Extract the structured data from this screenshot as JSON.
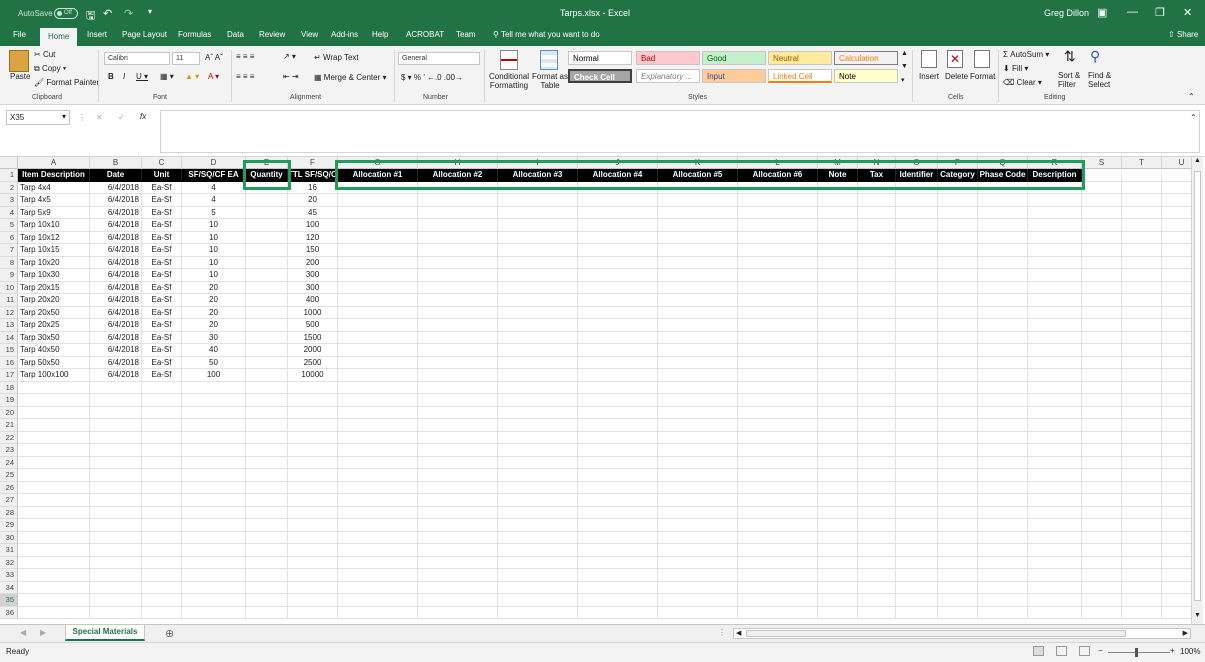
{
  "title_bar": {
    "autosave_label": "AutoSave",
    "autosave_state": "Off",
    "document": "Tarps.xlsx - Excel",
    "user": "Greg Dillon"
  },
  "tabs": [
    "File",
    "Home",
    "Insert",
    "Page Layout",
    "Formulas",
    "Data",
    "Review",
    "View",
    "Add-ins",
    "Help",
    "ACROBAT",
    "Team"
  ],
  "tell_me": "Tell me what you want to do",
  "share": "Share",
  "ribbon": {
    "clipboard": {
      "paste": "Paste",
      "cut": "Cut",
      "copy": "Copy",
      "format_painter": "Format Painter",
      "label": "Clipboard"
    },
    "font": {
      "name": "Calibri",
      "size": "11",
      "label": "Font"
    },
    "alignment": {
      "wrap_text": "Wrap Text",
      "merge_center": "Merge & Center",
      "label": "Alignment"
    },
    "number": {
      "format": "General",
      "label": "Number"
    },
    "styles": {
      "conditional": "Conditional Formatting",
      "format_as_table": "Format as Table",
      "items": [
        {
          "label": "Normal",
          "bg": "#ffffff",
          "fg": "#000000"
        },
        {
          "label": "Bad",
          "bg": "#ffc7ce",
          "fg": "#9c0006"
        },
        {
          "label": "Good",
          "bg": "#c6efce",
          "fg": "#006100"
        },
        {
          "label": "Neutral",
          "bg": "#ffeb9c",
          "fg": "#9c5700"
        },
        {
          "label": "Calculation",
          "bg": "#f2f2f2",
          "fg": "#fa7d00"
        },
        {
          "label": "Check Cell",
          "bg": "#a5a5a5",
          "fg": "#ffffff"
        },
        {
          "label": "Explanatory ...",
          "bg": "#ffffff",
          "fg": "#7f7f7f"
        },
        {
          "label": "Input",
          "bg": "#ffcc99",
          "fg": "#3f3f76"
        },
        {
          "label": "Linked Cell",
          "bg": "#ffffff",
          "fg": "#fa7d00"
        },
        {
          "label": "Note",
          "bg": "#ffffcc",
          "fg": "#000000"
        }
      ],
      "label": "Styles"
    },
    "cells": {
      "insert": "Insert",
      "delete": "Delete",
      "format": "Format",
      "label": "Cells"
    },
    "editing": {
      "autosum": "AutoSum",
      "fill": "Fill",
      "clear": "Clear",
      "sort_filter": "Sort & Filter",
      "find_select": "Find & Select",
      "label": "Editing"
    }
  },
  "name_box": "X35",
  "columns": [
    "A",
    "B",
    "C",
    "D",
    "E",
    "F",
    "G",
    "H",
    "I",
    "J",
    "K",
    "L",
    "M",
    "N",
    "O",
    "P",
    "Q",
    "R",
    "S",
    "T",
    "U"
  ],
  "header_row": [
    "Item Description",
    "Date",
    "Unit",
    "SF/SQ/CF EA",
    "Quantity",
    "TTL SF/SQ/CF",
    "Allocation #1",
    "Allocation #2",
    "Allocation #3",
    "Allocation #4",
    "Allocation #5",
    "Allocation #6",
    "Note",
    "Tax",
    "Identifier",
    "Category",
    "Phase Code",
    "Description"
  ],
  "rows": [
    [
      "Tarp 4x4",
      "6/4/2018",
      "Ea-Sf",
      "4",
      "",
      "16"
    ],
    [
      "Tarp 4x5",
      "6/4/2018",
      "Ea-Sf",
      "4",
      "",
      "20"
    ],
    [
      "Tarp 5x9",
      "6/4/2018",
      "Ea-Sf",
      "5",
      "",
      "45"
    ],
    [
      "Tarp 10x10",
      "6/4/2018",
      "Ea-Sf",
      "10",
      "",
      "100"
    ],
    [
      "Tarp 10x12",
      "6/4/2018",
      "Ea-Sf",
      "10",
      "",
      "120"
    ],
    [
      "Tarp 10x15",
      "6/4/2018",
      "Ea-Sf",
      "10",
      "",
      "150"
    ],
    [
      "Tarp 10x20",
      "6/4/2018",
      "Ea-Sf",
      "10",
      "",
      "200"
    ],
    [
      "Tarp 10x30",
      "6/4/2018",
      "Ea-Sf",
      "10",
      "",
      "300"
    ],
    [
      "Tarp 20x15",
      "6/4/2018",
      "Ea-Sf",
      "20",
      "",
      "300"
    ],
    [
      "Tarp 20x20",
      "6/4/2018",
      "Ea-Sf",
      "20",
      "",
      "400"
    ],
    [
      "Tarp 20x50",
      "6/4/2018",
      "Ea-Sf",
      "20",
      "",
      "1000"
    ],
    [
      "Tarp 20x25",
      "6/4/2018",
      "Ea-Sf",
      "20",
      "",
      "500"
    ],
    [
      "Tarp 30x50",
      "6/4/2018",
      "Ea-Sf",
      "30",
      "",
      "1500"
    ],
    [
      "Tarp 40x50",
      "6/4/2018",
      "Ea-Sf",
      "40",
      "",
      "2000"
    ],
    [
      "Tarp 50x50",
      "6/4/2018",
      "Ea-Sf",
      "50",
      "",
      "2500"
    ],
    [
      "Tarp 100x100",
      "6/4/2018",
      "Ea-Sf",
      "100",
      "",
      "10000"
    ]
  ],
  "row_count": 36,
  "sheet_tab": "Special Materials",
  "status": "Ready",
  "zoom": "100%",
  "accent": "#217346",
  "highlight": "#1e9e5a"
}
